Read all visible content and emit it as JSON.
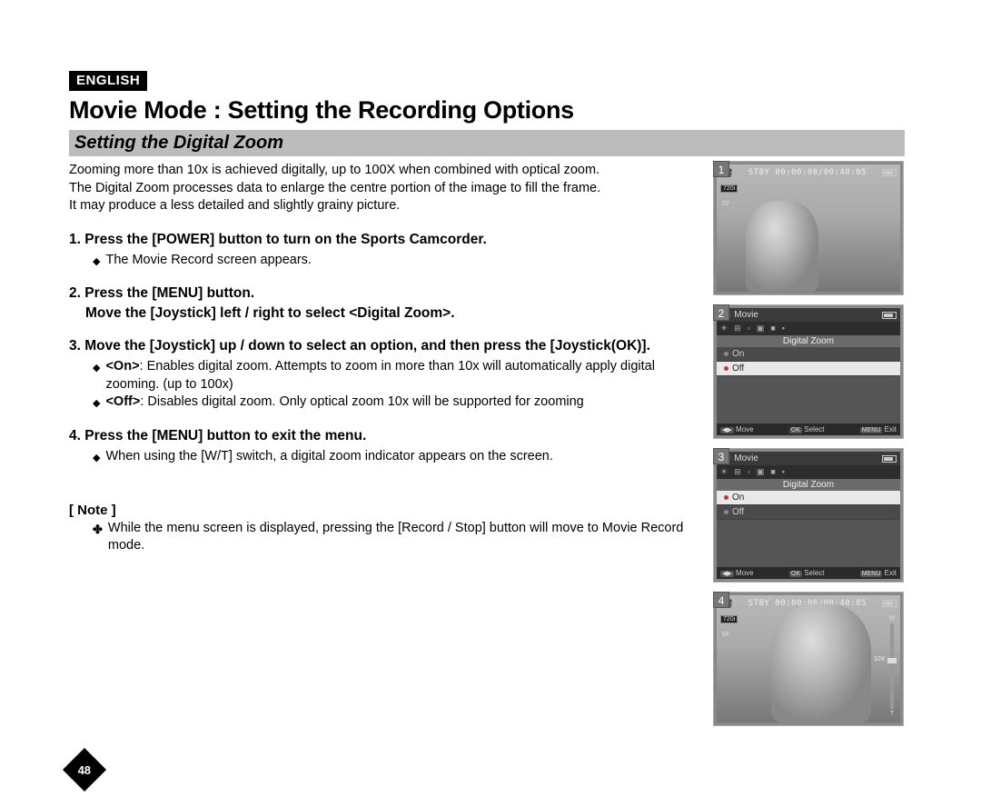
{
  "language_badge": "ENGLISH",
  "main_heading": "Movie Mode : Setting the Recording Options",
  "section_title": "Setting the Digital Zoom",
  "intro_lines": [
    "Zooming more than 10x is achieved digitally, up to 100X when combined with optical zoom.",
    "The Digital Zoom processes data to enlarge the centre portion of the image to fill the frame.",
    "It may produce a less detailed and slightly grainy picture."
  ],
  "steps": {
    "s1": {
      "head": "1. Press the [POWER] button to turn on the Sports Camcorder.",
      "sub": [
        "The Movie Record screen appears."
      ]
    },
    "s2": {
      "head_a": "2. Press the [MENU] button.",
      "head_b": "Move the [Joystick] left / right to select <Digital Zoom>."
    },
    "s3": {
      "head": "3. Move the [Joystick] up / down to select an option, and then press the [Joystick(OK)].",
      "opts": [
        {
          "label": "<On>",
          "text": ": Enables digital zoom. Attempts to zoom in more than 10x will automatically apply digital zooming. (up to 100x)"
        },
        {
          "label": "<Off>",
          "text": ": Disables digital zoom. Only optical zoom 10x will be supported for zooming"
        }
      ]
    },
    "s4": {
      "head": "4. Press the [MENU] button to exit the menu.",
      "sub": [
        "When using the [W/T] switch, a digital zoom indicator appears on the screen."
      ]
    }
  },
  "note_label": "[ Note ]",
  "note_text": "While the menu screen is displayed, pressing the [Record / Stop] button will move to Movie Record mode.",
  "page_number": "48",
  "osd": {
    "stby": "STBY",
    "timecode": "00:00:00/00:40:05",
    "res": "720i",
    "sf": "SF"
  },
  "menu": {
    "mode": "Movie",
    "section": "Digital Zoom",
    "on": "On",
    "off": "Off",
    "move": "Move",
    "select": "Select",
    "exit": "Exit",
    "ok": "OK",
    "menu": "MENU"
  },
  "thumb_numbers": [
    "1",
    "2",
    "3",
    "4"
  ],
  "zoom_labels": {
    "w": "W",
    "t": "T",
    "ten": "10X"
  }
}
